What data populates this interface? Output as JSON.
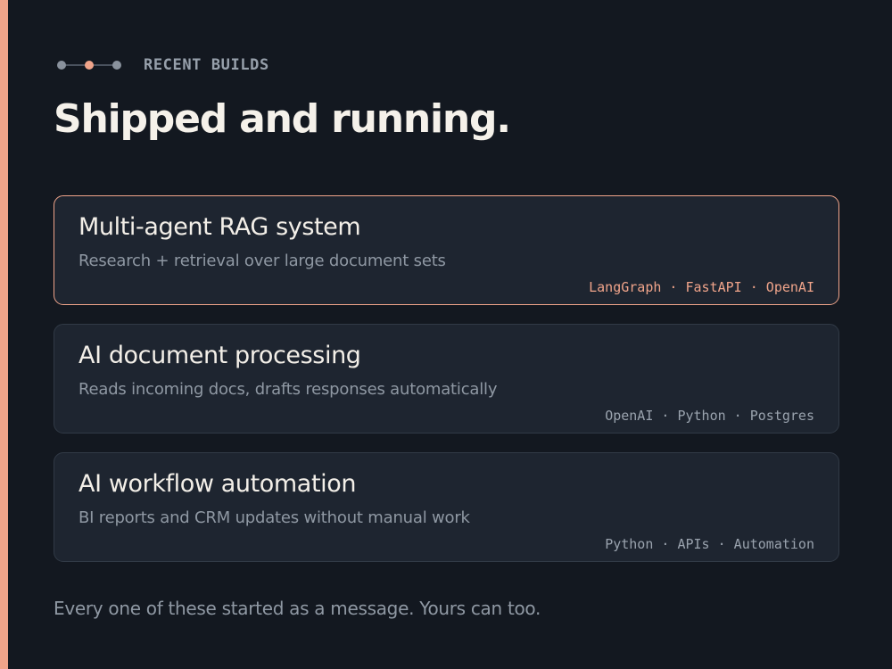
{
  "eyebrow": {
    "label": "RECENT BUILDS",
    "icon": "timeline-dots-icon"
  },
  "title": "Shipped and running.",
  "projects": [
    {
      "title": "Multi-agent RAG system",
      "description": "Research + retrieval over large document sets",
      "tags": "LangGraph · FastAPI · OpenAI",
      "highlighted": true
    },
    {
      "title": "AI document processing",
      "description": "Reads incoming docs, drafts responses automatically",
      "tags": "OpenAI · Python · Postgres",
      "highlighted": false
    },
    {
      "title": "AI workflow automation",
      "description": "BI reports and CRM updates without manual work",
      "tags": "Python · APIs · Automation",
      "highlighted": false
    }
  ],
  "footer": "Every one of these started as a message. Yours can too.",
  "colors": {
    "background": "#131820",
    "accent": "#f0a48a",
    "card_background": "#1e2530",
    "card_border": "#313a46",
    "title_text": "#f5f1ea",
    "muted_text": "#8f98a3"
  }
}
